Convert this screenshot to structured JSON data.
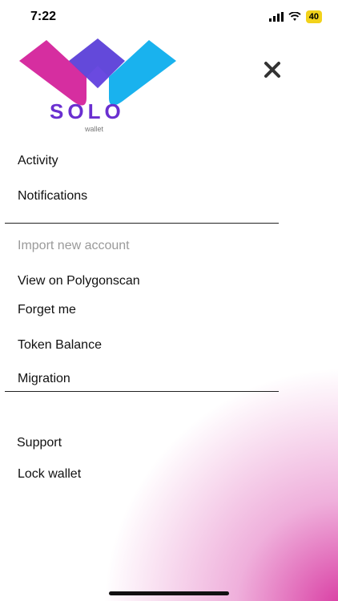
{
  "status_bar": {
    "time": "7:22",
    "battery": "40"
  },
  "logo": {
    "name": "SOLO",
    "subtitle": "wallet"
  },
  "menu": {
    "section1": [
      {
        "label": "Activity"
      },
      {
        "label": "Notifications"
      }
    ],
    "section2": [
      {
        "label": "Import new account",
        "disabled": true
      },
      {
        "label": "View on Polygonscan"
      },
      {
        "label": "Forget me"
      },
      {
        "label": "Token Balance"
      },
      {
        "label": "Migration"
      }
    ],
    "section3": [
      {
        "label": "Support"
      },
      {
        "label": "Lock wallet"
      }
    ]
  },
  "colors": {
    "logo_magenta": "#d62ea0",
    "logo_blue": "#19b2ee",
    "logo_purple": "#5b3fd8",
    "logo_text": "#6a2fd0",
    "gradient_pink": "#d62e9c"
  }
}
